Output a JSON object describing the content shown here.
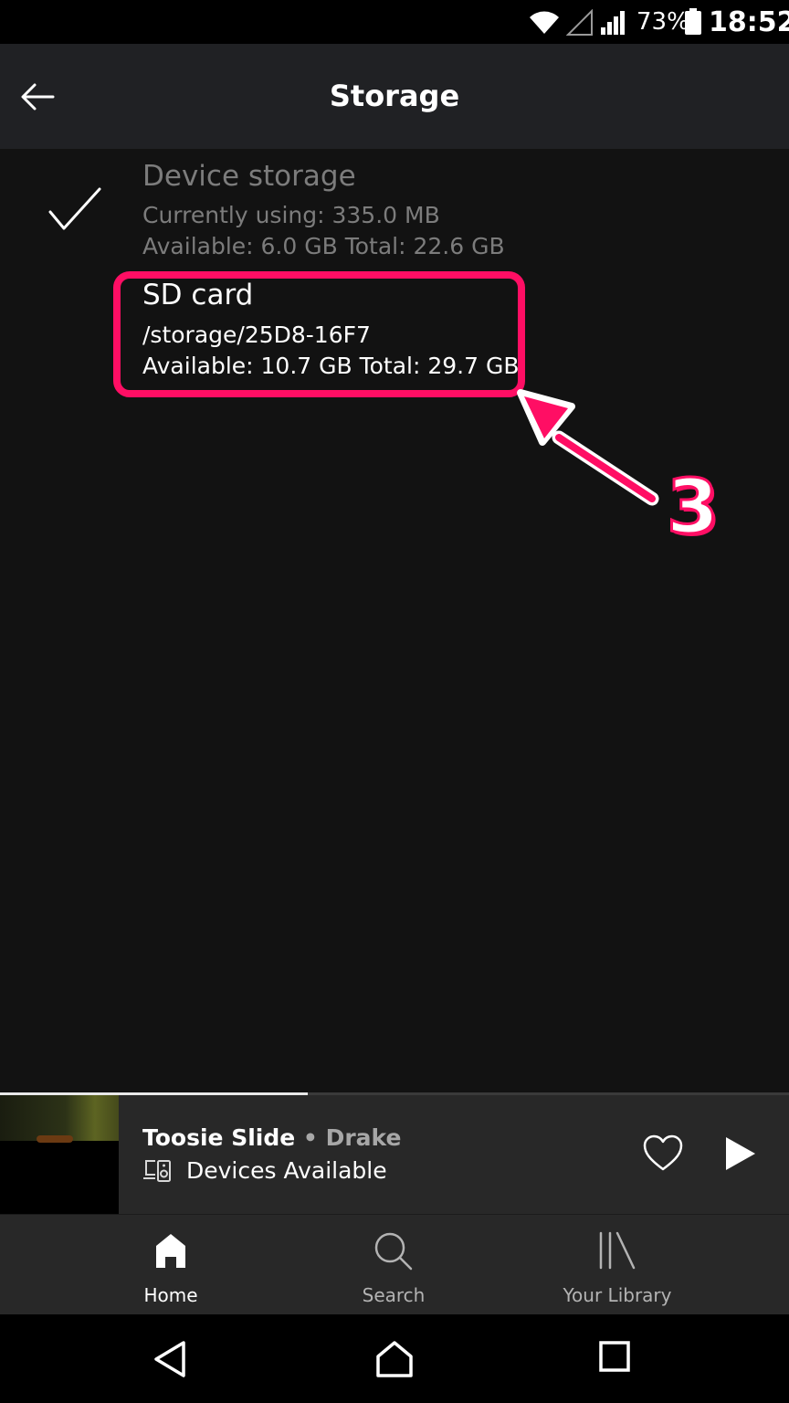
{
  "status_bar": {
    "battery_percent": "73%",
    "time": "18:52"
  },
  "header": {
    "title": "Storage"
  },
  "storage_options": {
    "device": {
      "title": "Device storage",
      "usage": "Currently using: 335.0 MB",
      "capacity": "Available: 6.0 GB Total: 22.6 GB",
      "selected": true
    },
    "sd_card": {
      "title": "SD card",
      "path": "/storage/25D8-16F7",
      "capacity": "Available: 10.7 GB Total: 29.7 GB"
    }
  },
  "annotation": {
    "step": "3",
    "color": "#ff0e64"
  },
  "mini_player": {
    "track": "Toosie Slide",
    "separator": " • ",
    "artist": "Drake",
    "devices_label": "Devices Available",
    "progress_fraction": 0.39
  },
  "bottom_nav": {
    "items": [
      {
        "label": "Home",
        "icon": "home-icon",
        "active": true
      },
      {
        "label": "Search",
        "icon": "search-icon",
        "active": false
      },
      {
        "label": "Your Library",
        "icon": "library-icon",
        "active": false
      }
    ]
  },
  "colors": {
    "background": "#121212",
    "header": "#202124",
    "player": "#282828",
    "muted_text": "#7c7c7c"
  }
}
